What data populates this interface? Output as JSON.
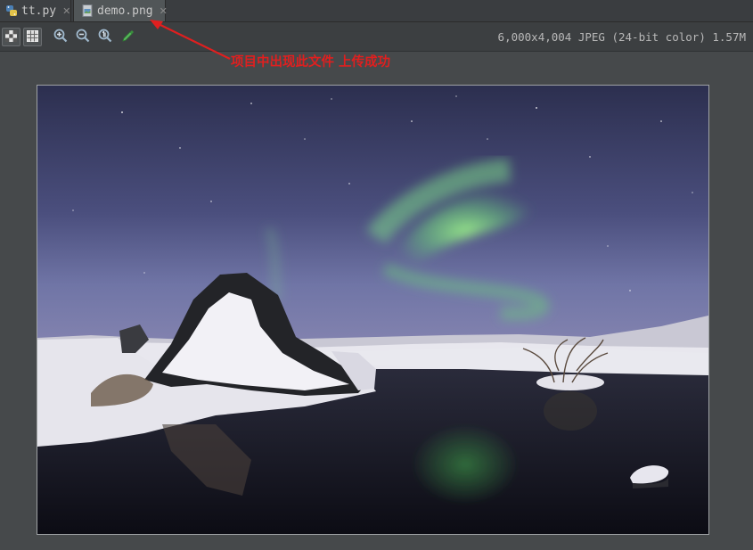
{
  "tabs": [
    {
      "label": "tt.py",
      "icon": "python-file-icon"
    },
    {
      "label": "demo.png",
      "icon": "image-file-icon"
    }
  ],
  "toolbar": {
    "buttons": [
      "chessboard-icon",
      "grid-icon",
      "zoom-in-icon",
      "zoom-out-icon",
      "actual-size-icon",
      "color-picker-icon"
    ]
  },
  "status": {
    "image_info": "6,000x4,004 JPEG (24-bit color) 1.57M"
  },
  "annotation": {
    "text": "项目中出现此文件  上传成功",
    "color": "#e01f1f"
  },
  "image": {
    "content": "aurora-night-landscape-photo"
  }
}
